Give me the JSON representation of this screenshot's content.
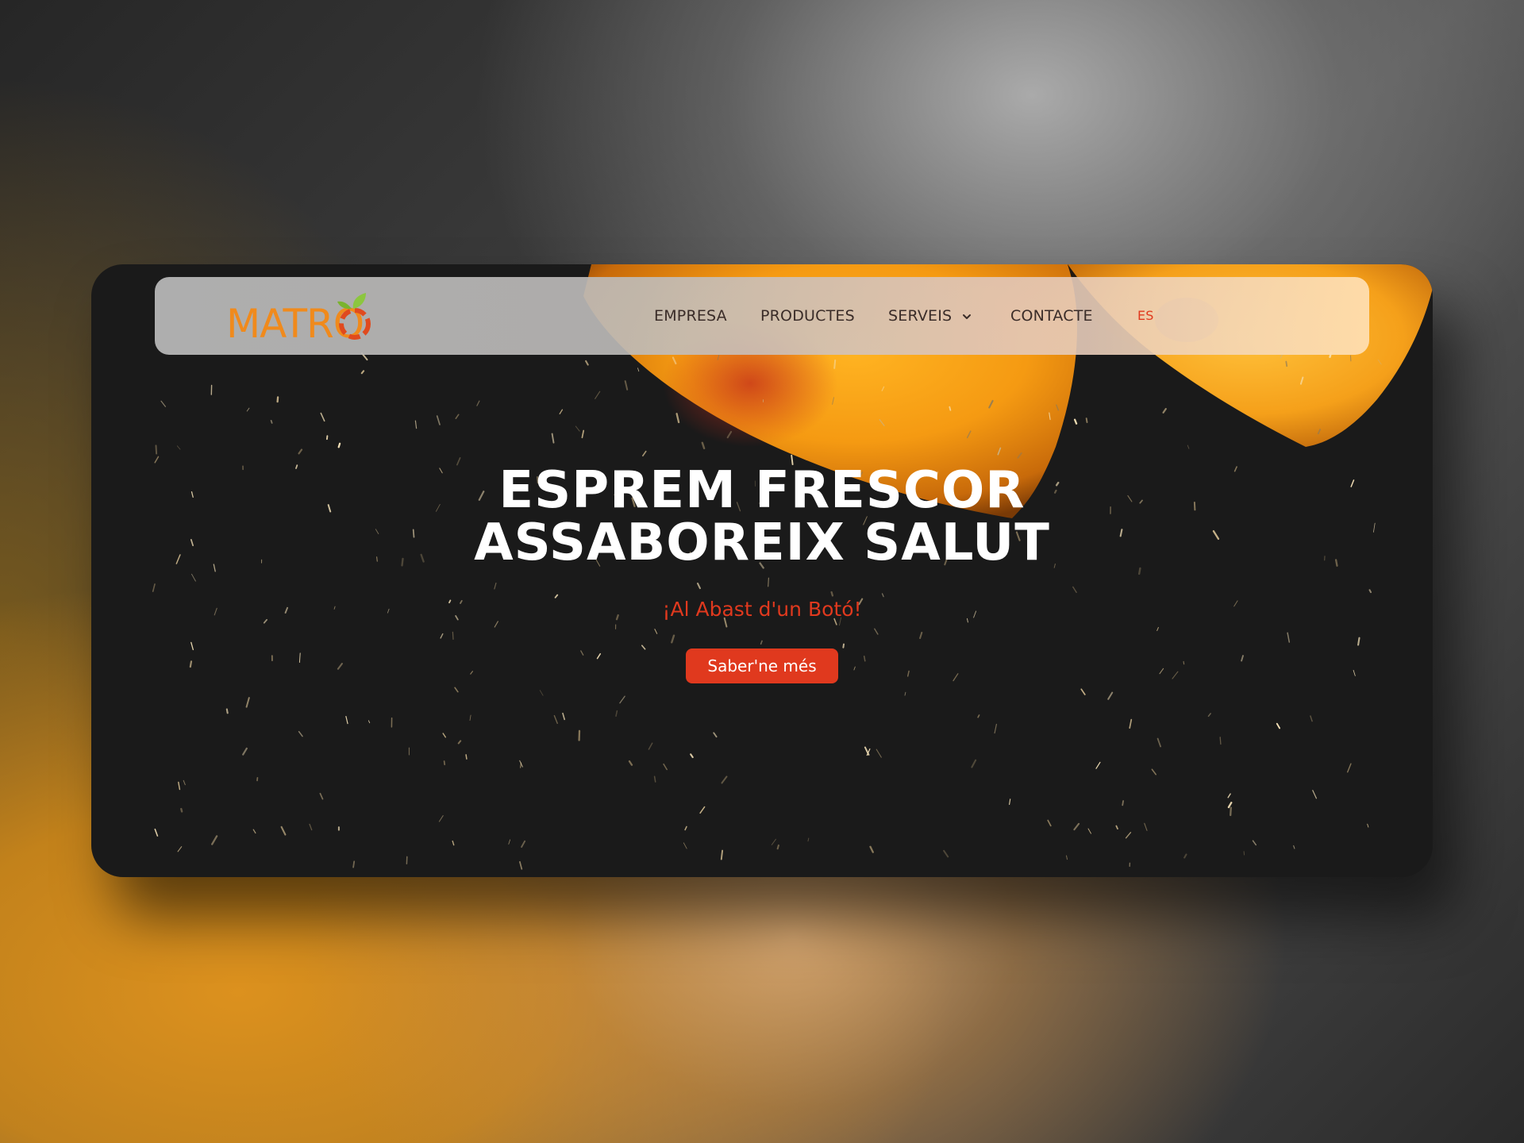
{
  "brand": {
    "logo_text": "MATRO",
    "logo_icon": "orange-fruit-icon"
  },
  "nav": {
    "items": [
      {
        "label": "EMPRESA"
      },
      {
        "label": "PRODUCTES"
      },
      {
        "label": "SERVEIS",
        "has_dropdown": true
      },
      {
        "label": "CONTACTE"
      }
    ],
    "language": "ES",
    "dropdown_icon": "chevron-down-icon"
  },
  "hero": {
    "title_line1": "ESPREM FRESCOR",
    "title_line2": "ASSABOREIX SALUT",
    "tagline": "¡Al Abast d'un Botó!",
    "cta_label": "Saber'ne més"
  },
  "colors": {
    "accent": "#e0391e",
    "logo_orange": "#f08a1c",
    "leaf_green": "#8cc63f",
    "card_bg": "#1a1a1a",
    "nav_text": "#3a2c28"
  }
}
